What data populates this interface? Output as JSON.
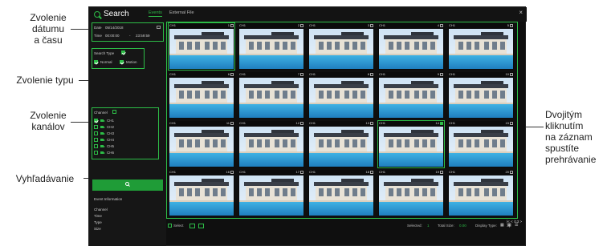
{
  "callouts": {
    "left": [
      {
        "name": "date-time-callout",
        "lines": [
          "Zvolenie",
          "dátumu",
          "a času"
        ]
      },
      {
        "name": "type-callout",
        "lines": [
          "Zvolenie typu"
        ]
      },
      {
        "name": "channel-callout",
        "lines": [
          "Zvolenie",
          "kanálov"
        ]
      },
      {
        "name": "search-callout",
        "lines": [
          "Vyhľadávanie"
        ]
      }
    ],
    "right": {
      "lines": [
        "Dvojitým",
        "kliknutím",
        "na záznam",
        "spustíte",
        "prehrávanie"
      ]
    }
  },
  "header": {
    "title": "Search",
    "tabs": [
      "Events",
      "External File"
    ],
    "close": "×"
  },
  "sidebar": {
    "date_label": "Date",
    "date_value": "05/14/2018",
    "time_label": "Time",
    "time_start": "00:00:00",
    "time_end": "23:59:59",
    "search_type_label": "Search Type",
    "types": [
      "Normal",
      "Motion"
    ],
    "channel_label": "Channel",
    "channels": [
      "CH1",
      "CH2",
      "CH3",
      "CH4",
      "CH5",
      "CH6"
    ],
    "event_info": {
      "title": "Event Information",
      "fields": [
        "Channel",
        "Time",
        "Type",
        "Size"
      ]
    }
  },
  "grid": {
    "thumbnails": [
      {
        "num": "1",
        "ch": "CH1"
      },
      {
        "num": "2",
        "ch": "CH1"
      },
      {
        "num": "3",
        "ch": "CH1"
      },
      {
        "num": "4",
        "ch": "CH1"
      },
      {
        "num": "5",
        "ch": "CH1"
      },
      {
        "num": "6",
        "ch": "CH1"
      },
      {
        "num": "7",
        "ch": "CH1"
      },
      {
        "num": "8",
        "ch": "CH1"
      },
      {
        "num": "9",
        "ch": "CH1"
      },
      {
        "num": "10",
        "ch": "CH1"
      },
      {
        "num": "11",
        "ch": "CH1"
      },
      {
        "num": "12",
        "ch": "CH1"
      },
      {
        "num": "13",
        "ch": "CH1"
      },
      {
        "num": "14",
        "ch": "CH1"
      },
      {
        "num": "15",
        "ch": "CH1"
      },
      {
        "num": "16",
        "ch": "CH1"
      },
      {
        "num": "17",
        "ch": "CH1"
      },
      {
        "num": "18",
        "ch": "CH1"
      },
      {
        "num": "19",
        "ch": "CH1"
      },
      {
        "num": "20",
        "ch": "CH1"
      }
    ]
  },
  "pagination": {
    "text": "/13"
  },
  "bottom": {
    "select_label": "Select",
    "selected_label": "Selected:",
    "selected_value": "1",
    "total_size_label": "Total Size:",
    "total_size_value": "0.00",
    "display_type_label": "Display Type:"
  },
  "colors": {
    "accent": "#2dbd47",
    "background": "#0f0f0f"
  }
}
